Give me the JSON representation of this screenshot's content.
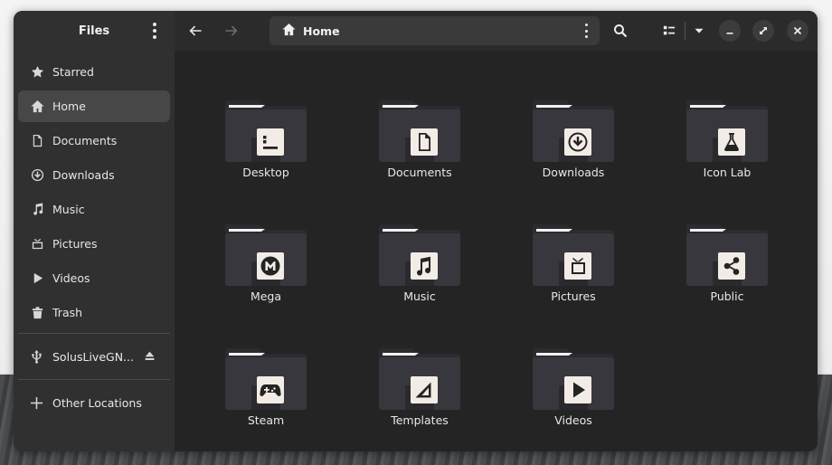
{
  "sidebar": {
    "title": "Files",
    "places": [
      {
        "label": "Starred",
        "icon": "star-icon",
        "active": false
      },
      {
        "label": "Home",
        "icon": "home-icon",
        "active": true
      },
      {
        "label": "Documents",
        "icon": "document-icon",
        "active": false
      },
      {
        "label": "Downloads",
        "icon": "download-icon",
        "active": false
      },
      {
        "label": "Music",
        "icon": "music-note-icon",
        "active": false
      },
      {
        "label": "Pictures",
        "icon": "picture-icon",
        "active": false
      },
      {
        "label": "Videos",
        "icon": "play-icon",
        "active": false
      },
      {
        "label": "Trash",
        "icon": "trash-icon",
        "active": false
      }
    ],
    "drive": {
      "label": "SolusLiveGN...",
      "icon": "usb-icon",
      "eject_icon": "eject-icon"
    },
    "other_locations": {
      "label": "Other Locations",
      "icon": "plus-icon"
    }
  },
  "headerbar": {
    "location": "Home",
    "back_icon": "arrow-left-icon",
    "forward_icon": "arrow-right-icon",
    "search_icon": "search-icon",
    "view_icon": "list-view-icon",
    "view_menu_icon": "chevron-down-icon"
  },
  "folders": [
    {
      "label": "Desktop",
      "emblem": "terminal-icon"
    },
    {
      "label": "Documents",
      "emblem": "document-icon"
    },
    {
      "label": "Downloads",
      "emblem": "download-icon"
    },
    {
      "label": "Icon Lab",
      "emblem": "flask-icon"
    },
    {
      "label": "Mega",
      "emblem": "mega-icon"
    },
    {
      "label": "Music",
      "emblem": "music-note-icon"
    },
    {
      "label": "Pictures",
      "emblem": "picture-icon"
    },
    {
      "label": "Public",
      "emblem": "share-icon"
    },
    {
      "label": "Steam",
      "emblem": "gamepad-icon"
    },
    {
      "label": "Templates",
      "emblem": "template-icon"
    },
    {
      "label": "Videos",
      "emblem": "play-icon"
    }
  ],
  "colors": {
    "sidebar_bg": "#303030",
    "content_bg": "#242424",
    "active_item": "#474747",
    "folder_body": "#35343a",
    "emblem_bg": "#f3ece6"
  }
}
